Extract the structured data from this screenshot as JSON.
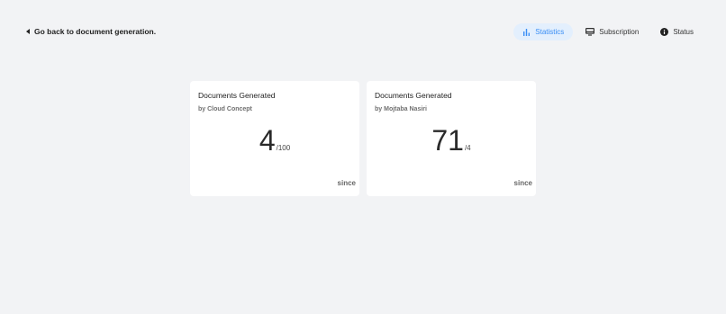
{
  "back_link": {
    "label": "Go back to document generation."
  },
  "nav": {
    "items": [
      {
        "label": "Statistics",
        "icon": "bar-chart-icon",
        "active": true
      },
      {
        "label": "Subscription",
        "icon": "monitor-icon",
        "active": false
      },
      {
        "label": "Status",
        "icon": "info-icon",
        "active": false
      }
    ]
  },
  "colors": {
    "background": "#f2f3f5",
    "card": "#ffffff",
    "accent": "#3a8ef5",
    "accent_bg": "#e3effd"
  },
  "cards": [
    {
      "title": "Documents Generated",
      "subtitle": "by Cloud Concept",
      "value": "4",
      "limit": "/100",
      "footer": "since"
    },
    {
      "title": "Documents Generated",
      "subtitle": "by Mojtaba Nasiri",
      "value": "71",
      "limit": "/4",
      "footer": "since"
    }
  ]
}
